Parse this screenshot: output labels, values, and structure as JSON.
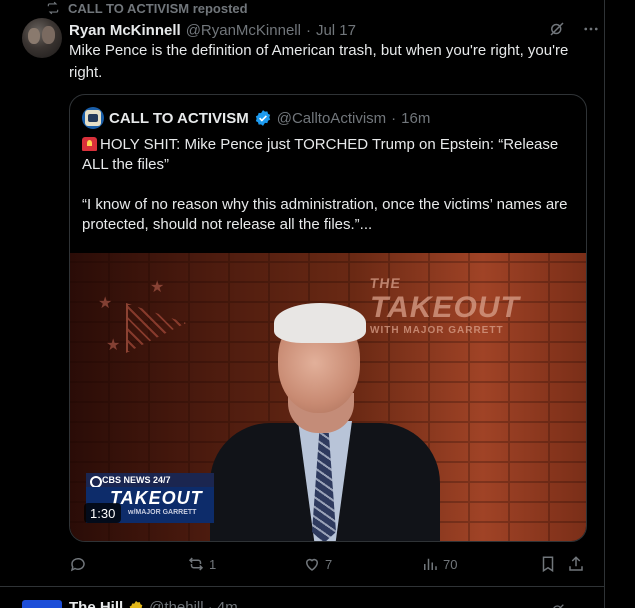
{
  "repost": {
    "label": "CALL TO ACTIVISM reposted"
  },
  "tweet": {
    "author_name": "Ryan McKinnell",
    "author_handle": "@RyanMcKinnell",
    "separator": "·",
    "time": "Jul 17",
    "text": "Mike Pence is the definition of American trash, but when you're right, you're right."
  },
  "quote": {
    "author_name": "CALL TO ACTIVISM",
    "author_handle": "@CalltoActivism",
    "separator": "·",
    "time": "16m",
    "text_line1": "HOLY SHIT: Mike Pence just TORCHED Trump on Epstein: “Release ALL the files”",
    "text_line2": "“I know of no reason why this administration, once the victims’ names are protected, should not release all the files.”..."
  },
  "video": {
    "bg_logo_the": "THE",
    "bg_logo_title": "TAKEOUT",
    "bg_logo_sub": "WITH MAJOR GARRETT",
    "network": "CBS NEWS 24/7",
    "show_title": "TAKEOUT",
    "show_host": "w/MAJOR GARRETT",
    "duration": "1:30"
  },
  "actions": {
    "reply_count": "",
    "repost_count": "1",
    "like_count": "7",
    "view_count": "70"
  },
  "next_tweet": {
    "author_name": "The Hill",
    "author_handle": "@thehill · 4m"
  },
  "colors": {
    "background": "#000000",
    "text": "#e7e9ea",
    "muted": "#71767b",
    "border": "#2f3336",
    "verified_blue": "#1d9bf0",
    "verified_gold": "#e2b719"
  }
}
